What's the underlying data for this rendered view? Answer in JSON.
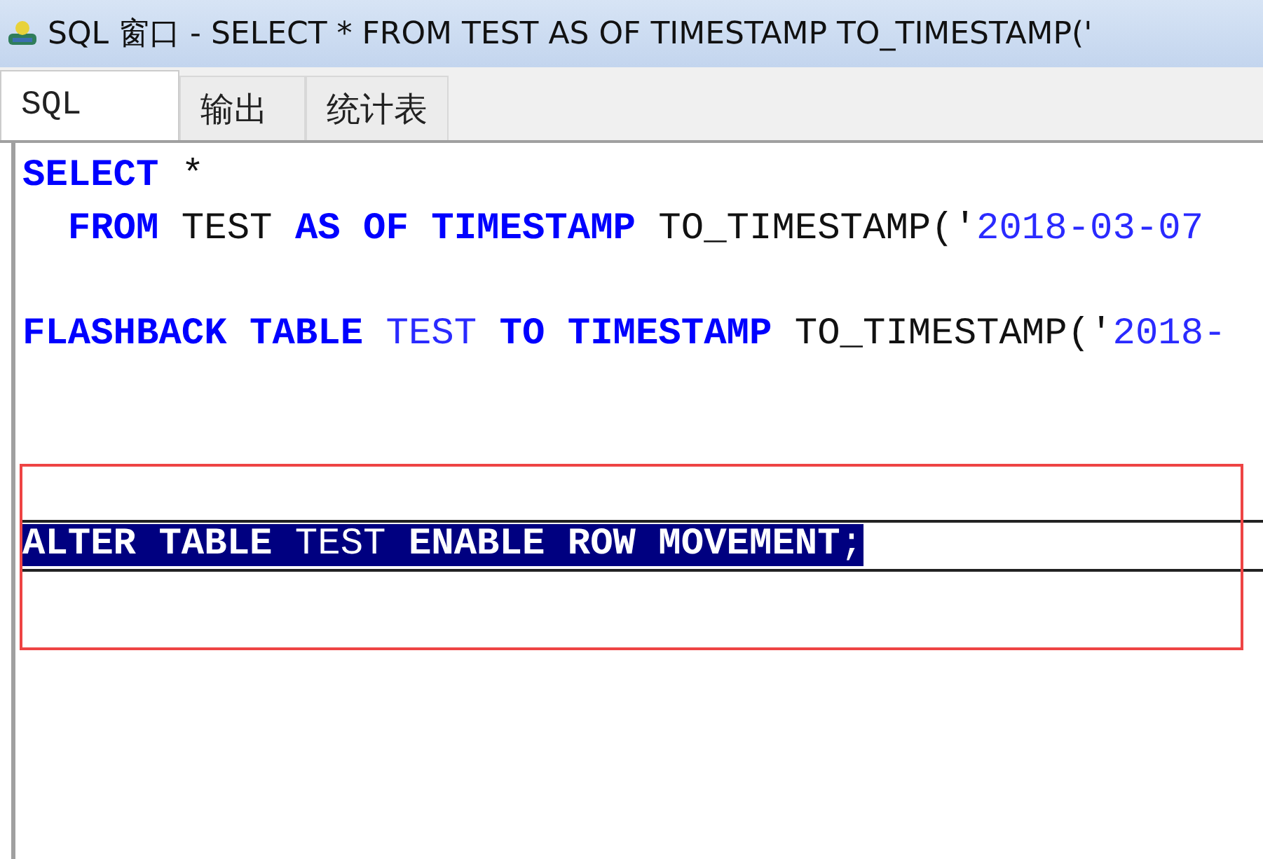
{
  "window": {
    "title": "SQL 窗口 - SELECT * FROM TEST AS OF TIMESTAMP TO_TIMESTAMP('"
  },
  "tabs": [
    {
      "label": "SQL",
      "selected": true
    },
    {
      "label": "输出",
      "selected": false
    },
    {
      "label": "统计表",
      "selected": false
    }
  ],
  "editor": {
    "lines": [
      {
        "kind": "code",
        "selected": false,
        "outlined": false,
        "tokens": [
          {
            "text": "SELECT",
            "kind": "keyword"
          },
          {
            "text": " *",
            "kind": "plain"
          }
        ]
      },
      {
        "kind": "code",
        "selected": false,
        "outlined": false,
        "tokens": [
          {
            "text": "  FROM",
            "kind": "keyword"
          },
          {
            "text": " TEST ",
            "kind": "plain"
          },
          {
            "text": "AS OF TIMESTAMP",
            "kind": "keyword"
          },
          {
            "text": " TO_TIMESTAMP('",
            "kind": "plain"
          },
          {
            "text": "2018-03-07",
            "kind": "string"
          }
        ]
      },
      {
        "kind": "blank"
      },
      {
        "kind": "code",
        "selected": false,
        "outlined": false,
        "tokens": [
          {
            "text": "FLASHBACK TABLE",
            "kind": "keyword"
          },
          {
            "text": " TEST ",
            "kind": "name"
          },
          {
            "text": "TO TIMESTAMP",
            "kind": "keyword"
          },
          {
            "text": " TO_TIMESTAMP('",
            "kind": "plain"
          },
          {
            "text": "2018-",
            "kind": "string"
          }
        ]
      },
      {
        "kind": "blank"
      },
      {
        "kind": "blank"
      },
      {
        "kind": "blank"
      },
      {
        "kind": "code",
        "selected": true,
        "outlined": true,
        "tokens": [
          {
            "text": "ALTER TABLE",
            "kind": "keyword"
          },
          {
            "text": " TEST ",
            "kind": "name"
          },
          {
            "text": "ENABLE ROW MOVEMENT",
            "kind": "keyword"
          },
          {
            "text": ";",
            "kind": "plain"
          }
        ]
      }
    ]
  }
}
